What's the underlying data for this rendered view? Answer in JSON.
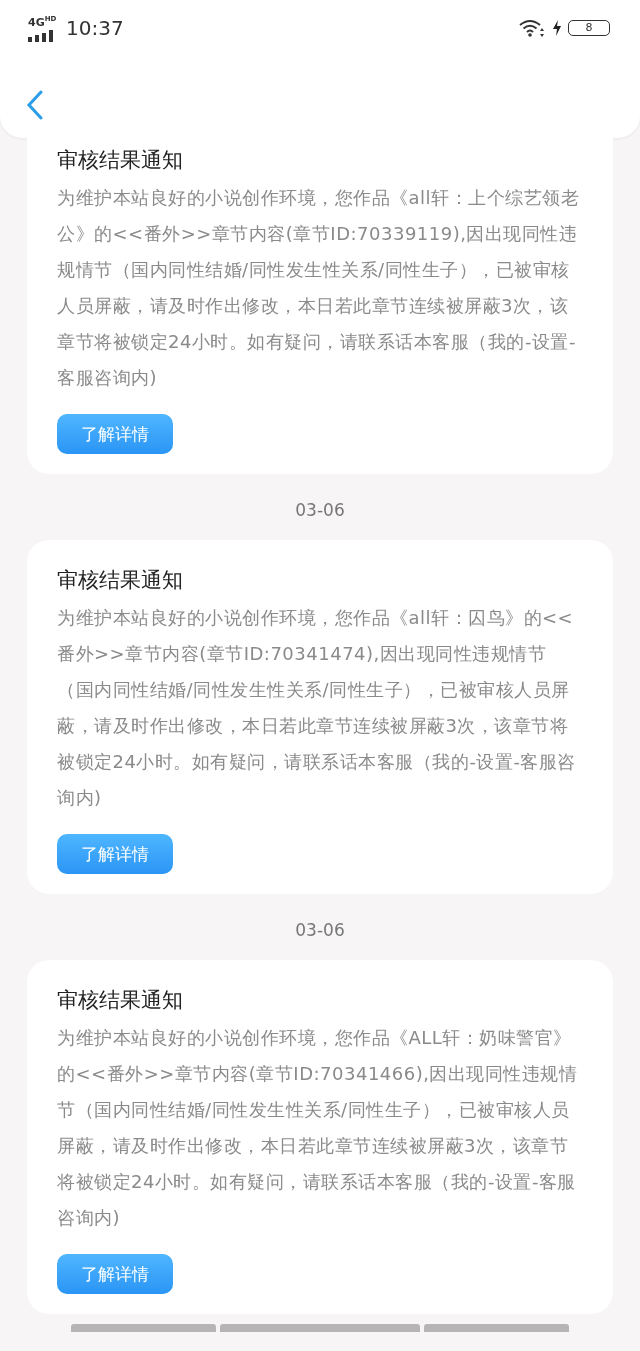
{
  "status_bar": {
    "network": "4G",
    "network_badge": "HD",
    "time": "10:37",
    "battery": "8"
  },
  "notices": [
    {
      "title": "审核结果通知",
      "body": "为维护本站良好的小说创作环境，您作品《all轩：上个综艺领老公》的<<番外>>章节内容(章节ID:70339119),因出现同性违规情节（国内同性结婚/同性发生性关系/同性生子），已被审核人员屏蔽，请及时作出修改，本日若此章节连续被屏蔽3次，该章节将被锁定24小时。如有疑问，请联系话本客服（我的-设置-客服咨询内)",
      "button": "了解详情"
    },
    {
      "date": "03-06",
      "title": "审核结果通知",
      "body": "为维护本站良好的小说创作环境，您作品《all轩：囚鸟》的<<番外>>章节内容(章节ID:70341474),因出现同性违规情节（国内同性结婚/同性发生性关系/同性生子），已被审核人员屏蔽，请及时作出修改，本日若此章节连续被屏蔽3次，该章节将被锁定24小时。如有疑问，请联系话本客服（我的-设置-客服咨询内)",
      "button": "了解详情"
    },
    {
      "date": "03-06",
      "title": "审核结果通知",
      "body": "为维护本站良好的小说创作环境，您作品《ALL轩：奶味警官》的<<番外>>章节内容(章节ID:70341466),因出现同性违规情节（国内同性结婚/同性发生性关系/同性生子），已被审核人员屏蔽，请及时作出修改，本日若此章节连续被屏蔽3次，该章节将被锁定24小时。如有疑问，请联系话本客服（我的-设置-客服咨询内)",
      "button": "了解详情"
    }
  ]
}
